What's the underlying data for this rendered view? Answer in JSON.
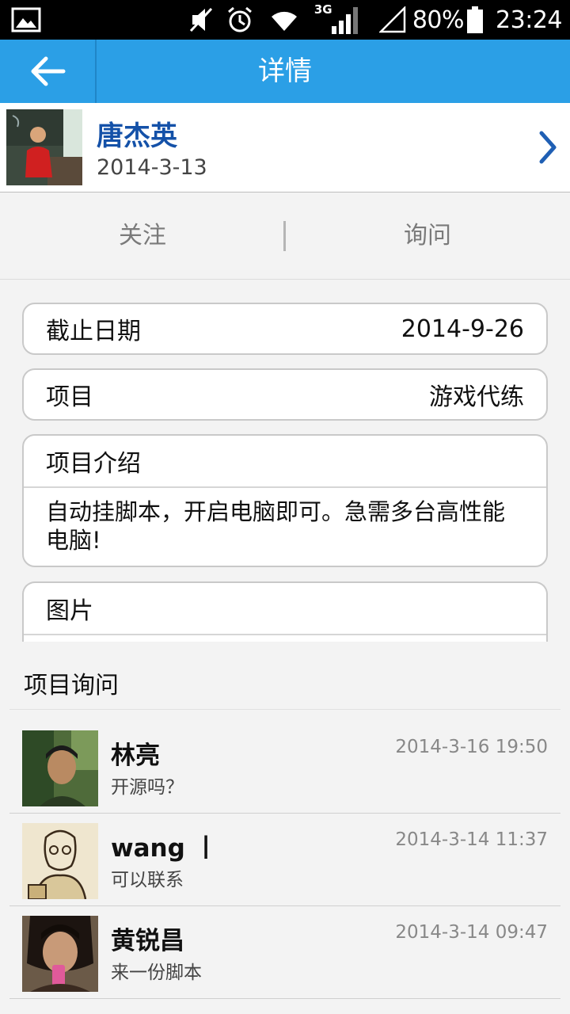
{
  "status_bar": {
    "battery": "80%",
    "time": "23:24",
    "network": "3G",
    "icons": [
      "gallery-icon",
      "mute-icon",
      "alarm-icon",
      "wifi-icon",
      "signal-icon",
      "signal-empty-icon",
      "battery-icon"
    ]
  },
  "header": {
    "title": "详情",
    "back_icon": "back-arrow-icon"
  },
  "publisher": {
    "name": "唐杰英",
    "date": "2014-3-13",
    "chevron_icon": "chevron-right-icon"
  },
  "actions": {
    "follow": "关注",
    "ask": "询问"
  },
  "details": {
    "deadline_label": "截止日期",
    "deadline_value": "2014-9-26",
    "project_label": "项目",
    "project_value": "游戏代练",
    "intro_label": "项目介绍",
    "intro_text": "自动挂脚本，开启电脑即可。急需多台高性能电脑!",
    "images_label": "图片"
  },
  "inquiries": {
    "title": "项目询问",
    "items": [
      {
        "name": "林亮",
        "message": "开源吗？",
        "time": "2014-3-16 19:50"
      },
      {
        "name": "wang  丨",
        "message": "可以联系",
        "time": "2014-3-14 11:37"
      },
      {
        "name": "黄锐昌",
        "message": "来一份脚本",
        "time": "2014-3-14 09:47"
      }
    ]
  },
  "colors": {
    "action_bar": "#2b9fe6",
    "publisher_name": "#1451a8",
    "status_bar": "#000000"
  }
}
